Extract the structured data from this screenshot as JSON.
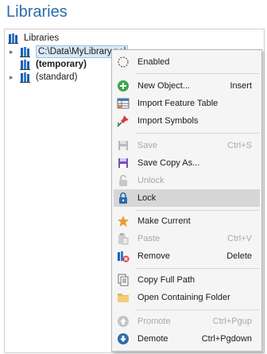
{
  "panel": {
    "title": "Libraries"
  },
  "tree": {
    "root_label": "Libraries",
    "items": [
      {
        "label": "C:\\Data\\MyLibrary.pol",
        "bold": false,
        "selected": true
      },
      {
        "label": "(temporary)",
        "bold": true,
        "selected": false
      },
      {
        "label": "(standard)",
        "bold": false,
        "selected": false
      }
    ]
  },
  "menu": {
    "items": [
      {
        "label": "Enabled",
        "shortcut": "",
        "icon": "checkbox-dashed-icon",
        "disabled": false
      },
      {
        "label": "New Object...",
        "shortcut": "Insert",
        "icon": "plus-circle-icon",
        "disabled": false
      },
      {
        "label": "Import Feature Table",
        "shortcut": "",
        "icon": "table-import-icon",
        "disabled": false
      },
      {
        "label": "Import Symbols",
        "shortcut": "",
        "icon": "pin-import-icon",
        "disabled": false
      },
      {
        "label": "Save",
        "shortcut": "Ctrl+S",
        "icon": "floppy-icon",
        "disabled": true
      },
      {
        "label": "Save Copy As...",
        "shortcut": "",
        "icon": "floppy-copy-icon",
        "disabled": false
      },
      {
        "label": "Unlock",
        "shortcut": "",
        "icon": "unlock-icon",
        "disabled": true
      },
      {
        "label": "Lock",
        "shortcut": "",
        "icon": "lock-icon",
        "disabled": false
      },
      {
        "label": "Make Current",
        "shortcut": "",
        "icon": "star-icon",
        "disabled": false
      },
      {
        "label": "Paste",
        "shortcut": "Ctrl+V",
        "icon": "paste-icon",
        "disabled": true
      },
      {
        "label": "Remove",
        "shortcut": "Delete",
        "icon": "library-remove-icon",
        "disabled": false
      },
      {
        "label": "Copy Full Path",
        "shortcut": "",
        "icon": "copy-path-icon",
        "disabled": false
      },
      {
        "label": "Open Containing Folder",
        "shortcut": "",
        "icon": "folder-icon",
        "disabled": false
      },
      {
        "label": "Promote",
        "shortcut": "Ctrl+Pgup",
        "icon": "arrow-up-circle-icon",
        "disabled": true
      },
      {
        "label": "Demote",
        "shortcut": "Ctrl+Pgdown",
        "icon": "arrow-down-circle-icon",
        "disabled": false
      }
    ],
    "highlighted": "Lock"
  },
  "colors": {
    "title": "#2b6dab",
    "library_blue": "#1f5fa8",
    "plus_green": "#3aa84a",
    "star_orange": "#e89b2c",
    "highlight": "#d6d6d6"
  }
}
